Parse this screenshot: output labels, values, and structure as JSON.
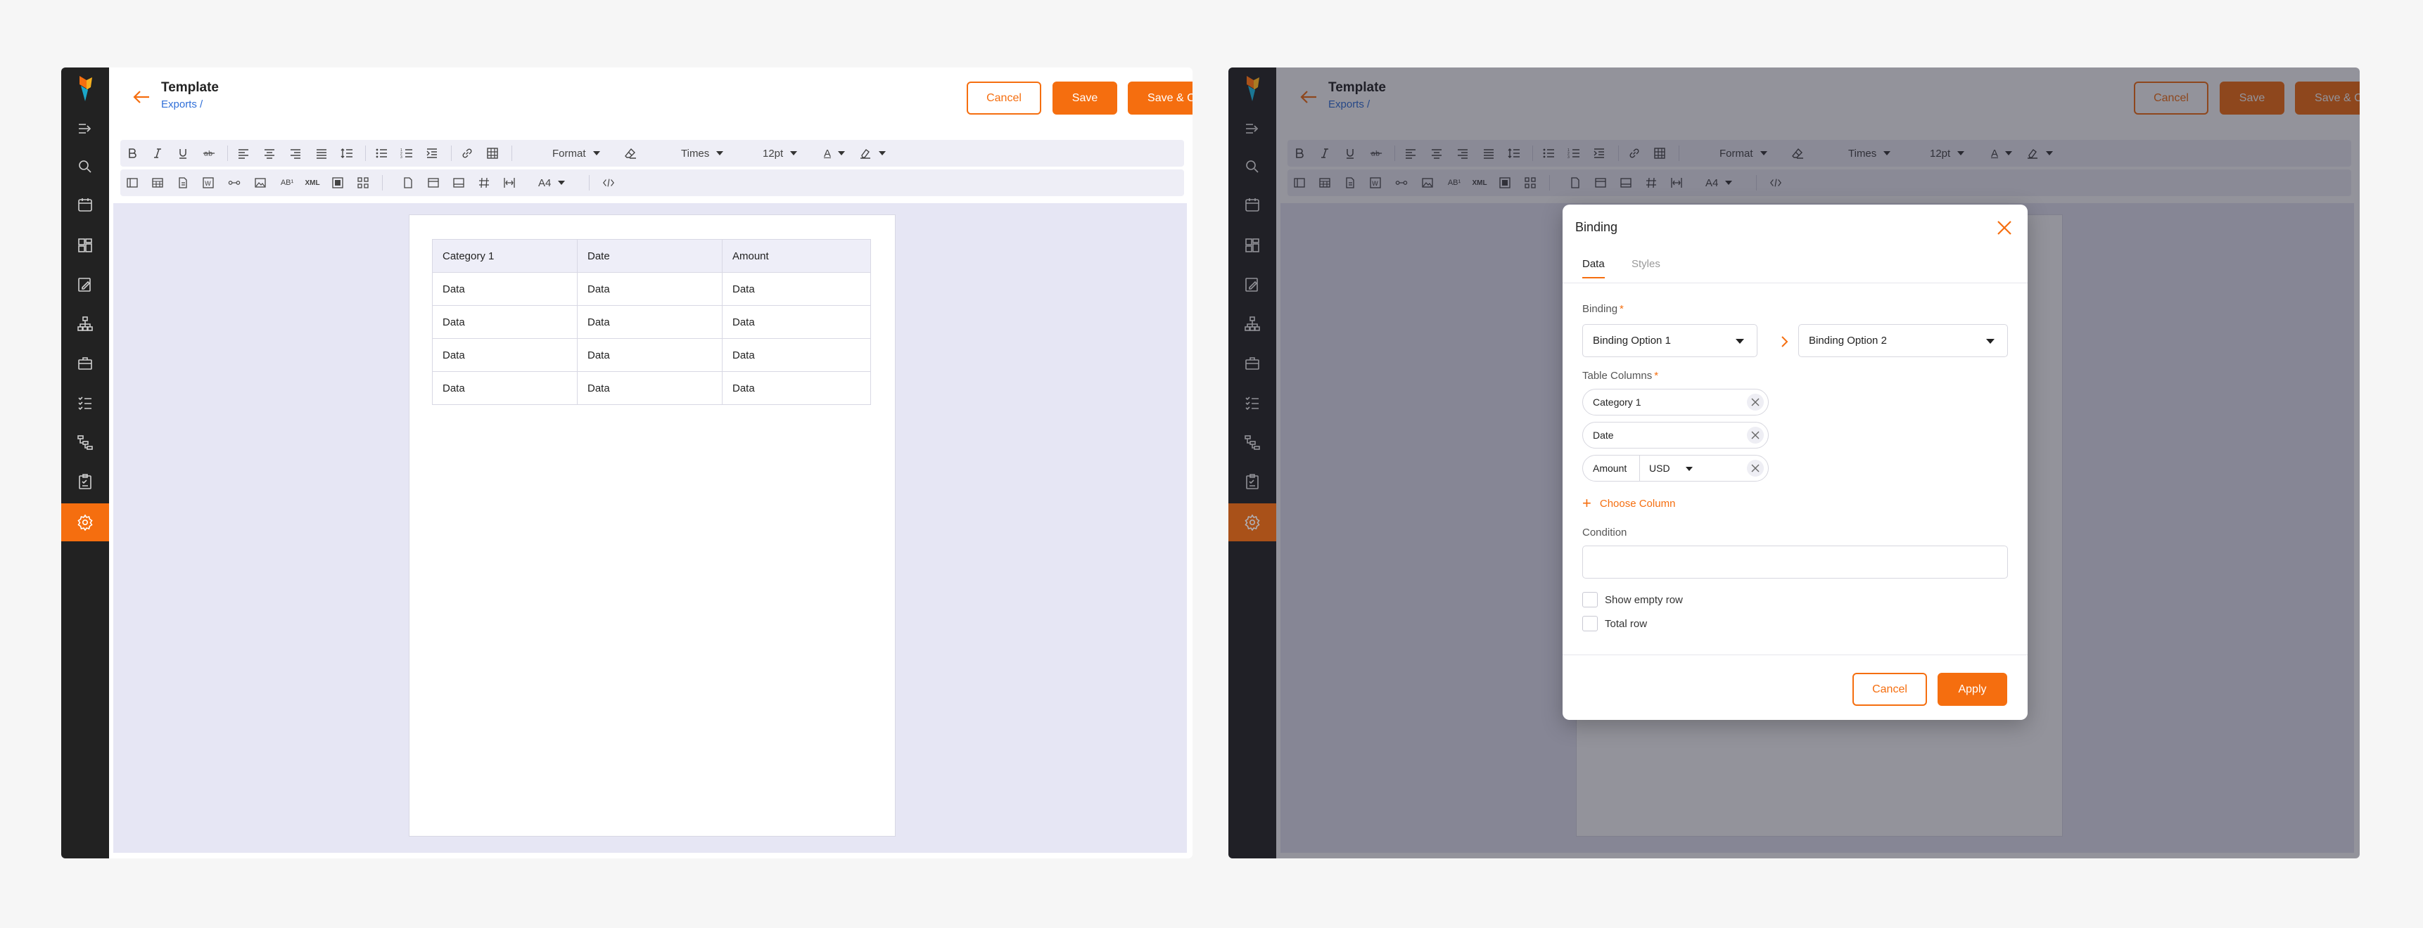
{
  "app": {
    "title": "Template",
    "breadcrumb": "Exports /"
  },
  "actions": {
    "cancel_label": "Cancel",
    "save_label": "Save",
    "save_close_label": "Save & Close"
  },
  "toolbar": {
    "format_label": "Format",
    "font_family": "Times",
    "font_size": "12pt",
    "page_size": "A4",
    "icons_row1": [
      "bold-icon",
      "italic-icon",
      "underline-icon",
      "strikethrough-icon",
      "align-left-icon",
      "align-center-icon",
      "align-right-icon",
      "align-justify-icon",
      "line-height-icon",
      "bullet-list-icon",
      "numbered-list-icon",
      "indent-icon",
      "link-icon",
      "table-icon",
      "clear-format-icon",
      "text-color-icon",
      "highlight-color-icon"
    ],
    "icons_row2": [
      "layout-icon",
      "table-grid-icon",
      "document-icon",
      "word-icon",
      "binding-icon",
      "image-icon",
      "superscript-icon",
      "xml-icon",
      "frame-icon",
      "qr-icon",
      "page-icon",
      "header-icon",
      "footer-icon",
      "hash-icon",
      "fit-width-icon",
      "code-icon"
    ],
    "text_color_glyph": "A",
    "superscript_glyph": "AB¹",
    "xml_glyph": "XML"
  },
  "doc_table": {
    "headers": [
      "Category 1",
      "Date",
      "Amount"
    ],
    "rows": [
      [
        "Data",
        "Data",
        "Data"
      ],
      [
        "Data",
        "Data",
        "Data"
      ],
      [
        "Data",
        "Data",
        "Data"
      ],
      [
        "Data",
        "Data",
        "Data"
      ]
    ]
  },
  "sidebar": {
    "items": [
      "expand-icon",
      "search-icon",
      "calendar-icon",
      "dashboard-icon",
      "edit-report-icon",
      "hierarchy-icon",
      "briefcase-icon",
      "checklist-icon",
      "workflow-icon",
      "clipboard-icon",
      "settings-icon"
    ],
    "active": "settings-icon"
  },
  "modal": {
    "title": "Binding",
    "tabs": [
      "Data",
      "Styles"
    ],
    "binding_label": "Binding",
    "binding_option_1": "Binding Option 1",
    "binding_option_2": "Binding Option 2",
    "table_columns_label": "Table Columns",
    "columns": [
      {
        "name": "Category 1"
      },
      {
        "name": "Date"
      },
      {
        "name": "Amount",
        "currency": "USD"
      }
    ],
    "choose_column_label": "Choose Column",
    "condition_label": "Condition",
    "condition_value": "",
    "show_empty_row_label": "Show empty row",
    "total_row_label": "Total row",
    "cancel_label": "Cancel",
    "apply_label": "Apply"
  },
  "colors": {
    "accent": "#f56e0f",
    "link": "#2f6fd8",
    "rail": "#222222",
    "canvas": "#e6e6f4"
  }
}
